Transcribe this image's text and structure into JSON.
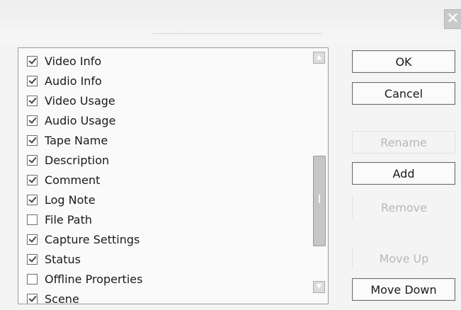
{
  "dialog": {
    "close_glyph": "✕"
  },
  "list": {
    "items": [
      {
        "label": "Video Info",
        "checked": true
      },
      {
        "label": "Audio Info",
        "checked": true
      },
      {
        "label": "Video Usage",
        "checked": true
      },
      {
        "label": "Audio Usage",
        "checked": true
      },
      {
        "label": "Tape Name",
        "checked": true
      },
      {
        "label": "Description",
        "checked": true
      },
      {
        "label": "Comment",
        "checked": true
      },
      {
        "label": "Log Note",
        "checked": true
      },
      {
        "label": "File Path",
        "checked": false
      },
      {
        "label": "Capture Settings",
        "checked": true
      },
      {
        "label": "Status",
        "checked": true
      },
      {
        "label": "Offline Properties",
        "checked": false
      },
      {
        "label": "Scene",
        "checked": true
      }
    ],
    "scroll_up_glyph": "▲",
    "scroll_down_glyph": "▼"
  },
  "buttons": {
    "ok": "OK",
    "cancel": "Cancel",
    "rename": "Rename",
    "add": "Add",
    "remove": "Remove",
    "move_up": "Move Up",
    "move_down": "Move Down"
  }
}
